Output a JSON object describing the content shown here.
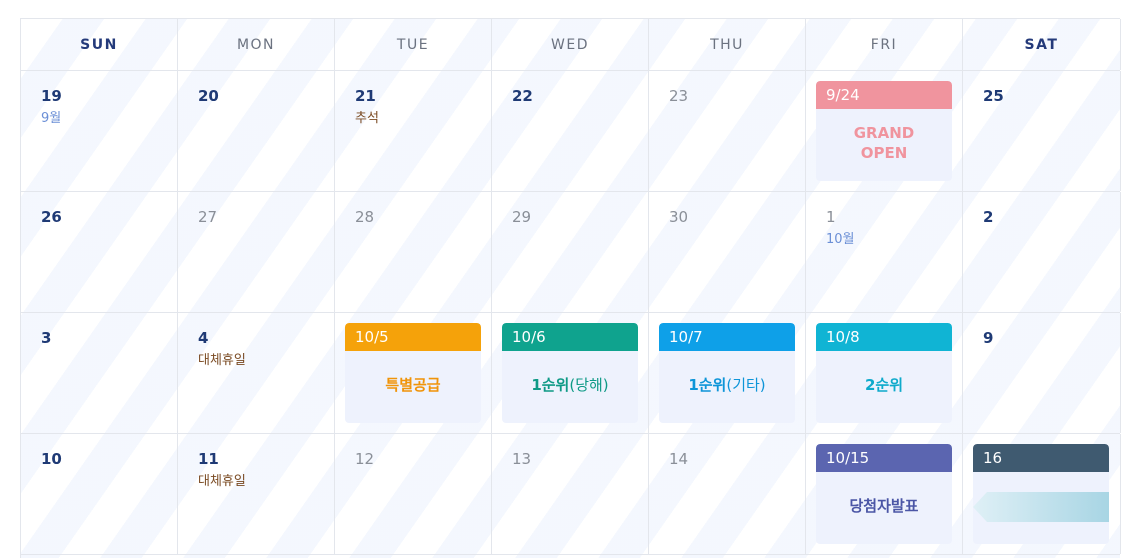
{
  "weekdays": [
    "SUN",
    "MON",
    "TUE",
    "WED",
    "THU",
    "FRI",
    "SAT"
  ],
  "weeks": [
    {
      "days": [
        {
          "num": "19",
          "sub": "9월"
        },
        {
          "num": "20",
          "sub": ""
        },
        {
          "num": "21",
          "sub": "추석"
        },
        {
          "num": "22",
          "sub": ""
        },
        {
          "num": "23",
          "sub": ""
        },
        {
          "event_head": "9/24",
          "event_body": "GRAND\nOPEN"
        },
        {
          "num": "25",
          "sub": ""
        }
      ]
    },
    {
      "days": [
        {
          "num": "26",
          "sub": ""
        },
        {
          "num": "27",
          "sub": ""
        },
        {
          "num": "28",
          "sub": ""
        },
        {
          "num": "29",
          "sub": ""
        },
        {
          "num": "30",
          "sub": ""
        },
        {
          "num": "1",
          "sub": "10월"
        },
        {
          "num": "2",
          "sub": ""
        }
      ]
    },
    {
      "days": [
        {
          "num": "3",
          "sub": ""
        },
        {
          "num": "4",
          "sub": "대체휴일"
        },
        {
          "event_head": "10/5",
          "event_body": "특별공급"
        },
        {
          "event_head": "10/6",
          "event_body_bold": "1순위",
          "event_body_rest": "(당해)"
        },
        {
          "event_head": "10/7",
          "event_body_bold": "1순위",
          "event_body_rest": "(기타)"
        },
        {
          "event_head": "10/8",
          "event_body": "2순위"
        },
        {
          "num": "9",
          "sub": ""
        }
      ]
    },
    {
      "days": [
        {
          "num": "10",
          "sub": ""
        },
        {
          "num": "11",
          "sub": "대체휴일"
        },
        {
          "num": "12",
          "sub": ""
        },
        {
          "num": "13",
          "sub": ""
        },
        {
          "num": "14",
          "sub": ""
        },
        {
          "event_head": "10/15",
          "event_body": "당첨자발표"
        },
        {
          "event_head": "16",
          "event_body": ""
        }
      ]
    }
  ],
  "colors": {
    "grand_open_head": "#f0949e",
    "grand_open_text": "#f0949e",
    "special_head": "#f5a20a",
    "special_text": "#f0940a",
    "first_local_head": "#0fa38e",
    "first_local_text": "#0f9a86",
    "first_other_head": "#0ea0e8",
    "first_other_text": "#0e95d8",
    "second_head": "#10b4d4",
    "second_text": "#0eaacb",
    "winner_head": "#5b65b0",
    "winner_text": "#4b56a6",
    "sat_event_head": "#3f5a70"
  }
}
